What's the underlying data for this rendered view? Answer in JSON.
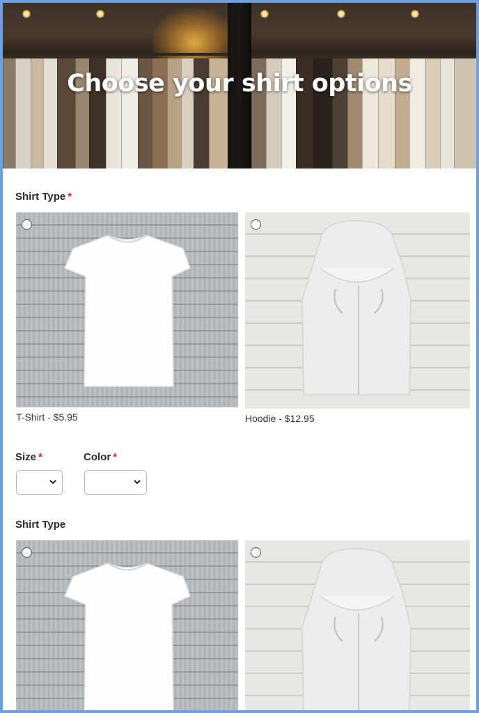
{
  "header": {
    "title": "Choose your shirt options"
  },
  "section1": {
    "label": "Shirt Type",
    "required_mark": "*",
    "options": [
      {
        "caption": "T-Shirt - $5.95",
        "icon": "t-shirt-image"
      },
      {
        "caption": "Hoodie - $12.95",
        "icon": "hoodie-image"
      }
    ]
  },
  "size": {
    "label": "Size",
    "required_mark": "*",
    "value": ""
  },
  "color": {
    "label": "Color",
    "required_mark": "*",
    "value": ""
  },
  "section2": {
    "label": "Shirt Type",
    "options": [
      {
        "icon": "t-shirt-image"
      },
      {
        "icon": "hoodie-image"
      }
    ]
  },
  "colors": {
    "accent_border": "#6aa0e6",
    "required": "#e02020"
  }
}
